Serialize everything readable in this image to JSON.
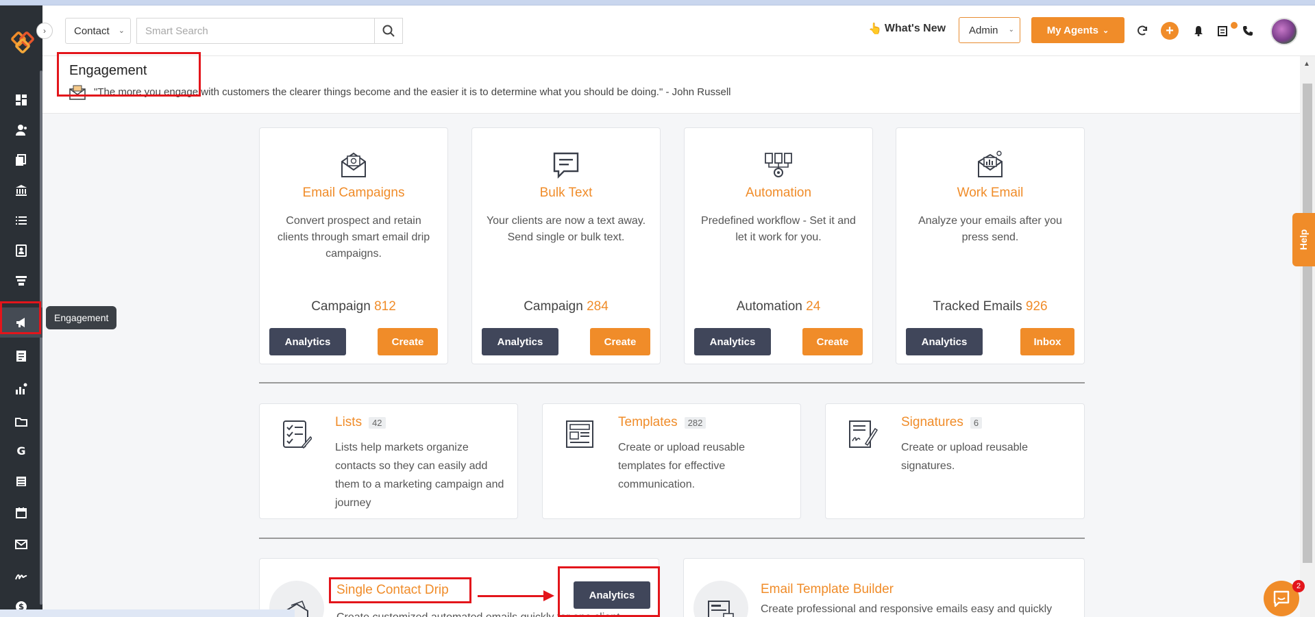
{
  "topbar": {
    "contact_select": "Contact",
    "search_placeholder": "Smart Search",
    "whats_new": "What's New",
    "whats_new_emoji": "👆",
    "admin_select": "Admin",
    "agents_button": "My Agents"
  },
  "page": {
    "title": "Engagement",
    "quote": "\"The more you engage with customers the clearer things become and the easier it is to determine what you should be doing.\" - John Russell"
  },
  "sidebar": {
    "tooltip": "Engagement",
    "items": [
      "dashboard-icon",
      "contacts-icon",
      "documents-icon",
      "bank-icon",
      "list-icon",
      "address-book-icon",
      "funnel-icon",
      "megaphone-icon",
      "notes-icon",
      "analytics-icon",
      "folder-icon",
      "google-icon",
      "spreadsheet-icon",
      "calendar-icon",
      "mail-icon",
      "signature-icon",
      "dollar-icon"
    ]
  },
  "cards": [
    {
      "title": "Email Campaigns",
      "desc": "Convert prospect and retain clients through smart email drip campaigns.",
      "stat_label": "Campaign",
      "stat_value": "812",
      "btn1": "Analytics",
      "btn2": "Create"
    },
    {
      "title": "Bulk Text",
      "desc": "Your clients are now a text away. Send single or bulk text.",
      "stat_label": "Campaign",
      "stat_value": "284",
      "btn1": "Analytics",
      "btn2": "Create"
    },
    {
      "title": "Automation",
      "desc": "Predefined workflow - Set it and let it work for you.",
      "stat_label": "Automation",
      "stat_value": "24",
      "btn1": "Analytics",
      "btn2": "Create"
    },
    {
      "title": "Work Email",
      "desc": "Analyze your emails after you press send.",
      "stat_label": "Tracked Emails",
      "stat_value": "926",
      "btn1": "Analytics",
      "btn2": "Inbox"
    }
  ],
  "cards2": [
    {
      "title": "Lists",
      "count": "42",
      "desc": "Lists help markets organize contacts so they can easily add them to a marketing campaign and journey"
    },
    {
      "title": "Templates",
      "count": "282",
      "desc": "Create or upload reusable templates for effective communication."
    },
    {
      "title": "Signatures",
      "count": "6",
      "desc": "Create or upload reusable signatures."
    }
  ],
  "cards3": [
    {
      "title": "Single Contact Drip",
      "button": "Analytics",
      "desc": "Create customized automated emails quickly for one client"
    },
    {
      "title": "Email Template Builder",
      "desc": "Create professional and responsive emails easy and quickly"
    }
  ],
  "help_tab": "Help",
  "chat_badge": "2",
  "colors": {
    "accent": "#f08c29",
    "dark_button": "#40465a",
    "highlight": "#e3151b",
    "sidebar": "#2b3036"
  }
}
